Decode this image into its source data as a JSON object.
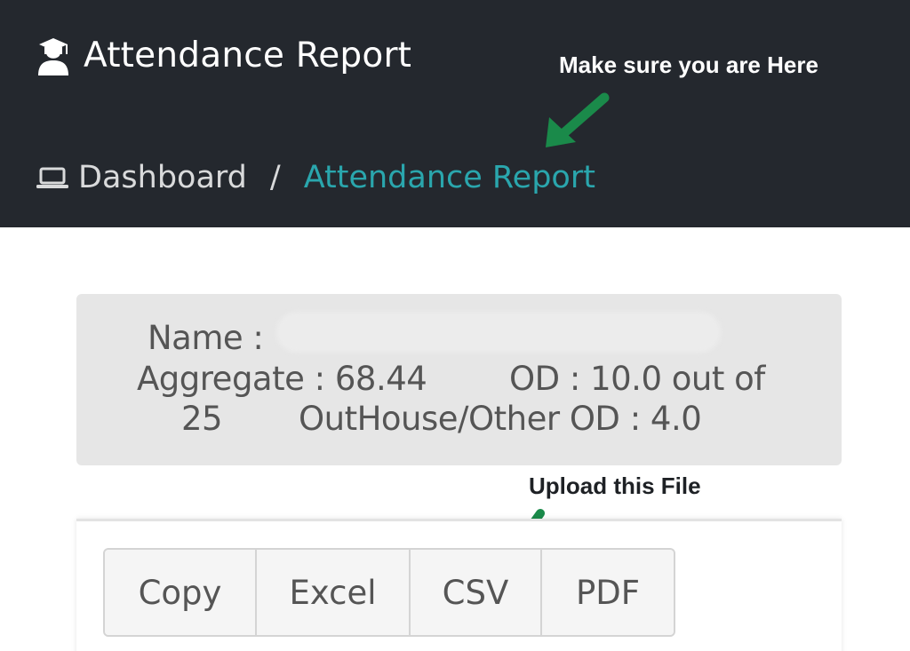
{
  "header": {
    "app_title": "Attendance Report",
    "app_icon": "graduate-icon",
    "background_color": "#24282e"
  },
  "breadcrumb": {
    "home_icon": "laptop-icon",
    "home_label": "Dashboard",
    "separator": "/",
    "current_label": "Attendance Report",
    "current_color": "#2aa6ad"
  },
  "annotations": {
    "top_note": "Make sure you are Here",
    "middle_note": "Upload this File",
    "arrow_color": "#1a8a4a"
  },
  "student_info": {
    "name_label": "Name :",
    "aggregate_label": "Aggregate : 68.44",
    "od_label": "OD : 10.0 out of",
    "od_total": "25",
    "outhouse_label": "OutHouse/Other OD : 4.0"
  },
  "export": {
    "buttons": [
      "Copy",
      "Excel",
      "CSV",
      "PDF"
    ]
  }
}
